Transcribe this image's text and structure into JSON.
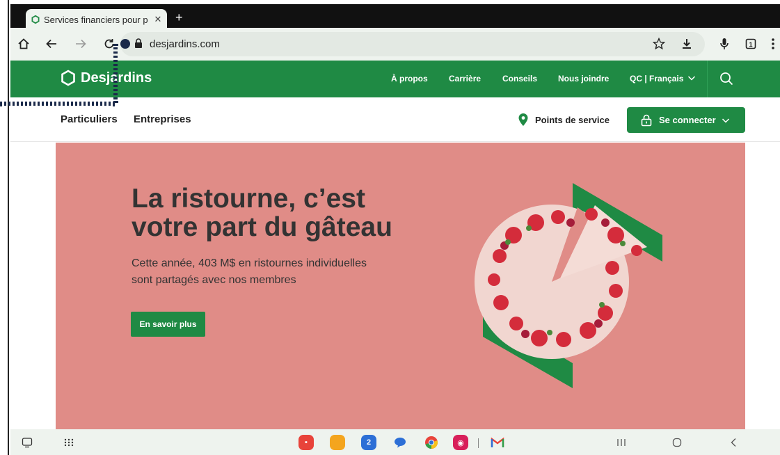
{
  "browser": {
    "tab_title": "Services financiers pour p",
    "url": "desjardins.com"
  },
  "nav": {
    "logo": "Desjardins",
    "links": [
      "À propos",
      "Carrière",
      "Conseils",
      "Nous joindre",
      "QC | Français"
    ]
  },
  "subnav": {
    "particuliers": "Particuliers",
    "entreprises": "Entreprises",
    "points": "Points de service",
    "connect": "Se connecter"
  },
  "hero": {
    "title_line1": "La ristourne, c’est",
    "title_line2": "votre part du gâteau",
    "subtitle_line1": "Cette année, 403 M$ en ristournes individuelles",
    "subtitle_line2": "sont partagés avec nos membres",
    "cta": "En savoir plus"
  },
  "taskbar": {
    "calendar_day": "2"
  },
  "colors": {
    "brand_green": "#1f8a44",
    "hero_bg": "#e08c87",
    "chrome_bg": "#eef3ee"
  }
}
